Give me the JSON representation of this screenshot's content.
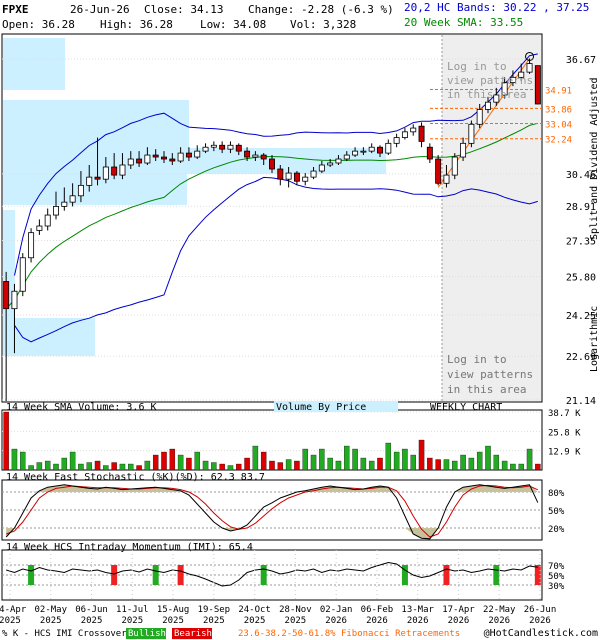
{
  "header": {
    "symbol": "FPXE",
    "date": "26-Jun-26",
    "close": "Close: 34.13",
    "change": "Change: -2.28 (-6.3 %)",
    "open": "Open: 36.28",
    "high": "High: 36.28",
    "low": "Low: 34.08",
    "vol": "Vol: 3,328",
    "bands": "20,2 HC Bands: 30.22 , 37.25",
    "sma": "20 Week SMA: 33.55"
  },
  "colors": {
    "up": "#ffffff",
    "down": "#cc0000",
    "candle_outline": "#000000",
    "bands": "#0000cc",
    "sma": "#008800",
    "vbp": "#ccf0ff",
    "vol_up": "#22aa22",
    "vol_down": "#dd0000",
    "stoch_k": "#000000",
    "stoch_d": "#cc0000",
    "stoch_fill": "#c8c29a",
    "fib": "#ff6600",
    "shade": "#eeeeee"
  },
  "price_axis": {
    "ticks": [
      "36.67",
      "30.46",
      "28.91",
      "27.35",
      "25.80",
      "24.25",
      "22.69",
      "21.14"
    ]
  },
  "fib_levels": [
    "34.91",
    "33.86",
    "33.04",
    "32.24"
  ],
  "side_label": "Split and Dividend Adjusted",
  "side_label2": "Logarithmic",
  "login_top": "Log in to\nview patterns\nin this area",
  "login_bottom": [
    "Log in to",
    "view patterns",
    "in this area"
  ],
  "volume": {
    "label": "14 Week SMA Volume: 3.6 K",
    "vbp_label": "Volume By Price",
    "weekly": "WEEKLY CHART",
    "ticks": [
      "38.7 K",
      "25.8 K",
      "12.9 K"
    ]
  },
  "stochastic": {
    "label": "14 Week Fast Stochastic (%K)(%D): 62.3 83.7",
    "ticks": [
      "80%",
      "50%",
      "20%"
    ]
  },
  "imi": {
    "label": "14 Week HCS Intraday Momentum (IMI): 65.4",
    "ticks": [
      "70%",
      "50%",
      "30%"
    ]
  },
  "x_labels": [
    [
      "04-Apr",
      "2025"
    ],
    [
      "02-May",
      "2025"
    ],
    [
      "06-Jun",
      "2025"
    ],
    [
      "11-Jul",
      "2025"
    ],
    [
      "15-Aug",
      "2025"
    ],
    [
      "19-Sep",
      "2025"
    ],
    [
      "24-Oct",
      "2025"
    ],
    [
      "28-Nov",
      "2025"
    ],
    [
      "02-Jan",
      "2026"
    ],
    [
      "06-Feb",
      "2026"
    ],
    [
      "13-Mar",
      "2026"
    ],
    [
      "17-Apr",
      "2026"
    ],
    [
      "22-May",
      "2026"
    ],
    [
      "26-Jun",
      "2026"
    ]
  ],
  "footer": {
    "legend_prefix": "% K - HCS IMI Crossover,",
    "bullish": "Bullish",
    "bearish": "Bearish",
    "fib": "23.6-38.2-50-61.8% Fibonacci Retracements",
    "copyright": "@HotCandlestick.com"
  },
  "chart_data": [
    {
      "type": "candlestick",
      "title": "FPXE",
      "weeks": 65,
      "ylim": [
        21.14,
        36.67
      ],
      "close": [
        24.5,
        25.2,
        26.6,
        27.7,
        28.0,
        28.5,
        28.9,
        29.1,
        29.4,
        29.9,
        30.3,
        30.2,
        30.8,
        30.4,
        30.9,
        31.2,
        31.0,
        31.4,
        31.3,
        31.2,
        31.1,
        31.5,
        31.3,
        31.6,
        31.8,
        31.9,
        31.7,
        31.9,
        31.6,
        31.3,
        31.4,
        31.2,
        30.7,
        30.2,
        30.5,
        30.1,
        30.3,
        30.6,
        30.9,
        31.0,
        31.2,
        31.4,
        31.6,
        31.6,
        31.8,
        31.5,
        32.0,
        32.3,
        32.6,
        32.8,
        32.1,
        31.2,
        30.0,
        30.4,
        31.3,
        32.0,
        33.0,
        33.8,
        34.2,
        34.6,
        35.3,
        35.6,
        35.9,
        36.4,
        34.1
      ],
      "open": [
        25.6,
        24.5,
        25.2,
        26.6,
        27.8,
        28.0,
        28.5,
        28.9,
        29.1,
        29.4,
        29.9,
        30.3,
        30.2,
        30.8,
        30.4,
        30.9,
        31.2,
        31.0,
        31.4,
        31.3,
        31.2,
        31.1,
        31.5,
        31.3,
        31.6,
        31.8,
        31.9,
        31.7,
        31.9,
        31.6,
        31.3,
        31.4,
        31.2,
        30.7,
        30.2,
        30.5,
        30.1,
        30.3,
        30.6,
        30.9,
        31.0,
        31.2,
        31.4,
        31.6,
        31.6,
        31.8,
        31.5,
        32.0,
        32.3,
        32.6,
        32.9,
        31.8,
        31.2,
        30.0,
        30.4,
        31.3,
        32.0,
        33.0,
        33.8,
        34.2,
        34.6,
        35.3,
        35.6,
        35.9,
        36.28
      ],
      "high": [
        26.0,
        25.5,
        26.8,
        27.9,
        28.3,
        28.8,
        29.6,
        29.8,
        30.0,
        30.6,
        30.9,
        32.3,
        31.3,
        31.5,
        31.5,
        31.6,
        31.6,
        31.8,
        31.7,
        31.6,
        31.5,
        31.8,
        31.8,
        31.9,
        32.0,
        32.1,
        32.1,
        32.1,
        32.0,
        31.8,
        31.6,
        31.5,
        31.4,
        30.9,
        30.8,
        30.6,
        30.5,
        30.8,
        31.1,
        31.2,
        31.4,
        31.6,
        31.8,
        31.8,
        32.0,
        31.9,
        32.2,
        32.5,
        32.8,
        33.0,
        33.1,
        32.0,
        31.4,
        30.9,
        31.5,
        32.3,
        33.2,
        34.1,
        34.5,
        35.0,
        35.6,
        36.0,
        36.4,
        36.7,
        36.28
      ],
      "low": [
        21.1,
        22.8,
        25.0,
        26.4,
        27.6,
        27.8,
        28.3,
        28.7,
        28.9,
        29.1,
        29.6,
        29.9,
        30.0,
        30.2,
        30.2,
        30.7,
        30.8,
        30.9,
        31.1,
        31.0,
        30.9,
        31.0,
        31.1,
        31.2,
        31.5,
        31.6,
        31.5,
        31.5,
        31.4,
        31.1,
        31.1,
        30.9,
        30.5,
        29.9,
        29.8,
        29.9,
        29.9,
        30.2,
        30.5,
        30.8,
        30.9,
        31.1,
        31.3,
        31.4,
        31.5,
        31.3,
        31.4,
        31.8,
        32.2,
        32.4,
        31.8,
        31.0,
        29.9,
        29.8,
        30.2,
        31.1,
        31.8,
        32.8,
        33.6,
        34.0,
        34.4,
        35.1,
        35.4,
        35.8,
        34.08
      ]
    },
    {
      "type": "bar",
      "title": "14 Week SMA Volume: 3.6 K",
      "ylim": [
        0,
        38.7
      ],
      "values": [
        38.7,
        14,
        12,
        3,
        5,
        6,
        4,
        8,
        12,
        4,
        5,
        6,
        3,
        5,
        4,
        4,
        3,
        6,
        10,
        12,
        14,
        10,
        8,
        12,
        6,
        5,
        4,
        3,
        4,
        8,
        16,
        12,
        6,
        5,
        7,
        6,
        14,
        10,
        14,
        8,
        6,
        16,
        14,
        8,
        6,
        8,
        18,
        12,
        14,
        10,
        20,
        8,
        7,
        7,
        6,
        10,
        8,
        12,
        16,
        10,
        6,
        4,
        4,
        14,
        4
      ]
    },
    {
      "type": "line",
      "title": "14 Week Fast Stochastic (%K)(%D): 62.3 83.7",
      "ylim": [
        0,
        100
      ],
      "series": [
        {
          "name": "%K",
          "values": [
            5,
            20,
            45,
            70,
            82,
            88,
            90,
            92,
            90,
            88,
            86,
            85,
            88,
            86,
            84,
            85,
            86,
            87,
            88,
            86,
            84,
            82,
            75,
            60,
            45,
            30,
            20,
            15,
            18,
            25,
            40,
            55,
            62,
            70,
            75,
            80,
            82,
            85,
            88,
            90,
            88,
            86,
            84,
            85,
            88,
            90,
            88,
            70,
            40,
            10,
            3,
            2,
            20,
            55,
            80,
            88,
            90,
            92,
            90,
            88,
            86,
            88,
            90,
            92,
            62.3
          ]
        },
        {
          "name": "%D",
          "values": [
            10,
            15,
            30,
            50,
            70,
            80,
            86,
            88,
            90,
            89,
            88,
            87,
            87,
            87,
            86,
            85,
            85,
            86,
            87,
            87,
            86,
            84,
            80,
            72,
            60,
            45,
            32,
            22,
            18,
            20,
            28,
            40,
            52,
            62,
            70,
            75,
            80,
            82,
            85,
            87,
            88,
            87,
            86,
            85,
            86,
            88,
            88,
            82,
            65,
            40,
            18,
            5,
            10,
            30,
            55,
            75,
            85,
            90,
            91,
            90,
            88,
            87,
            88,
            90,
            83.7
          ]
        }
      ]
    },
    {
      "type": "line",
      "title": "14 Week HCS Intraday Momentum (IMI): 65.4",
      "ylim": [
        0,
        100
      ],
      "series": [
        {
          "name": "IMI",
          "values": [
            60,
            55,
            62,
            58,
            65,
            60,
            58,
            55,
            62,
            60,
            58,
            60,
            55,
            52,
            58,
            60,
            56,
            62,
            58,
            55,
            60,
            58,
            52,
            48,
            42,
            35,
            28,
            30,
            40,
            55,
            60,
            62,
            58,
            52,
            55,
            60,
            58,
            62,
            55,
            60,
            58,
            62,
            60,
            58,
            65,
            70,
            75,
            72,
            60,
            50,
            45,
            48,
            55,
            62,
            58,
            60,
            55,
            58,
            62,
            60,
            58,
            62,
            60,
            68,
            65.4
          ]
        }
      ]
    }
  ]
}
